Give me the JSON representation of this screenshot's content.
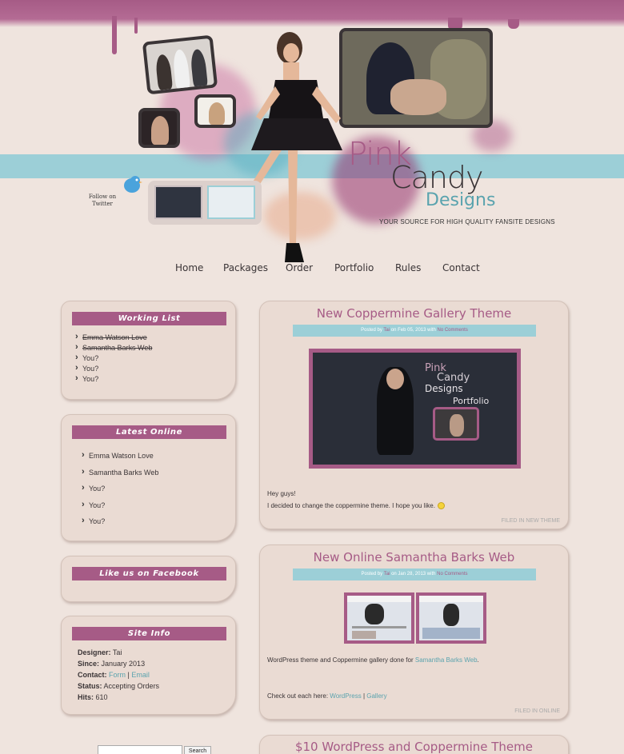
{
  "header": {
    "follow_twitter": "Follow on Twitter",
    "logo_pink": "Pink",
    "logo_candy": "Candy",
    "logo_designs": "Designs",
    "tagline": "YOUR SOURCE FOR HIGH QUALITY FANSITE DESIGNS"
  },
  "nav": {
    "items": [
      {
        "label": "Home"
      },
      {
        "label": "Packages"
      },
      {
        "label": "Order"
      },
      {
        "label": "Portfolio"
      },
      {
        "label": "Rules"
      },
      {
        "label": "Contact"
      }
    ]
  },
  "sidebar": {
    "working_list": {
      "title": "Working List",
      "items": [
        "Emma Watson Love",
        "Samantha Barks Web",
        "You?",
        "You?",
        "You?"
      ]
    },
    "latest_online": {
      "title": "Latest Online",
      "items": [
        "Emma Watson Love",
        "Samantha Barks Web",
        "You?",
        "You?",
        "You?"
      ]
    },
    "facebook": {
      "title": "Like us on Facebook"
    },
    "site_info": {
      "title": "Site Info",
      "designer_label": "Designer:",
      "designer": "Tai",
      "since_label": "Since:",
      "since": "January 2013",
      "contact_label": "Contact:",
      "contact_form": "Form",
      "contact_sep": "|",
      "contact_email": "Email",
      "status_label": "Status:",
      "status": "Accepting Orders",
      "hits_label": "Hits:",
      "hits": "610"
    },
    "search": {
      "button": "Search",
      "placeholder": ""
    }
  },
  "posts": [
    {
      "title": "New Coppermine Gallery Theme",
      "meta_prefix": "Posted by",
      "author": "Tai",
      "meta_date": "on Feb 05, 2013 with",
      "comments": "No Comments",
      "screenshot_text": {
        "pink": "Pink",
        "candy": "Candy",
        "designs": "Designs",
        "portfolio": "Portfolio"
      },
      "para1": "Hey guys!",
      "para2": "I decided to change the coppermine theme. I hope you like.",
      "filed": "FILED IN NEW THEME"
    },
    {
      "title": "New Online Samantha Barks Web",
      "meta_prefix": "Posted by",
      "author": "Tai",
      "meta_date": "on Jan 28, 2013 with",
      "comments": "No Comments",
      "para1_prefix": "WordPress theme and Coppermine gallery done for",
      "para1_link": "Samantha Barks Web",
      "para1_suffix": ".",
      "para2_prefix": "Check out each here:",
      "link_wordpress": "WordPress",
      "sep": "|",
      "link_gallery": "Gallery",
      "filed": "FILED IN ONLINE"
    },
    {
      "title": "$10 WordPress and Coppermine Theme"
    }
  ],
  "colors": {
    "background": "#efe4de",
    "pink_accent": "#a65b86",
    "teal_accent": "#9ccfd7",
    "link_teal": "#5aa3ae",
    "box_fill": "#eadbd3"
  }
}
